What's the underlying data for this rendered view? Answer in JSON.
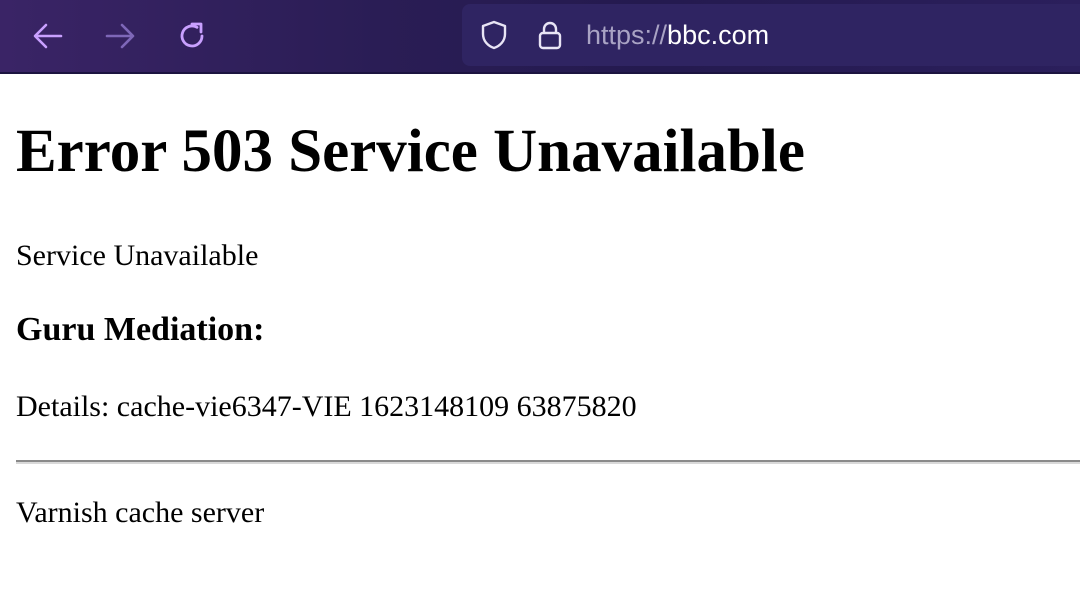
{
  "browser": {
    "url_scheme": "https://",
    "url_host": "bbc.com",
    "colors": {
      "toolbar": "#2a1d55",
      "nav_icon_active": "#c9a0ff",
      "nav_icon_disabled": "#7e67b8",
      "url_scheme": "#a9a3c4",
      "url_host": "#ffffff"
    },
    "icons": [
      "back-arrow-icon",
      "forward-arrow-icon",
      "reload-icon",
      "shield-icon",
      "lock-icon"
    ]
  },
  "page": {
    "heading": "Error 503 Service Unavailable",
    "message": "Service Unavailable",
    "subheading": "Guru Mediation:",
    "details": "Details: cache-vie6347-VIE 1623148109 63875820",
    "footer": "Varnish cache server"
  }
}
